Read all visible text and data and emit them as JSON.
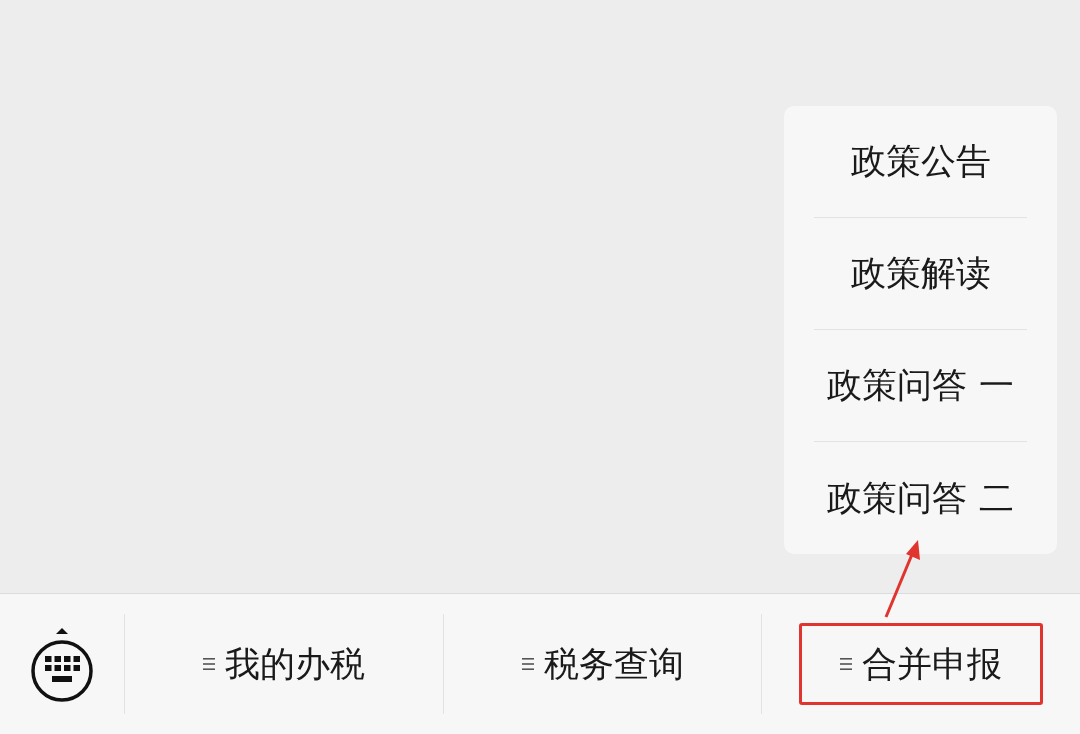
{
  "menu_bar": {
    "items": [
      {
        "label": "我的办税",
        "highlighted": false
      },
      {
        "label": "税务查询",
        "highlighted": false
      },
      {
        "label": "合并申报",
        "highlighted": true
      }
    ]
  },
  "submenu": {
    "items": [
      {
        "label": "政策公告"
      },
      {
        "label": "政策解读"
      },
      {
        "label": "政策问答 一"
      },
      {
        "label": "政策问答 二"
      }
    ]
  }
}
